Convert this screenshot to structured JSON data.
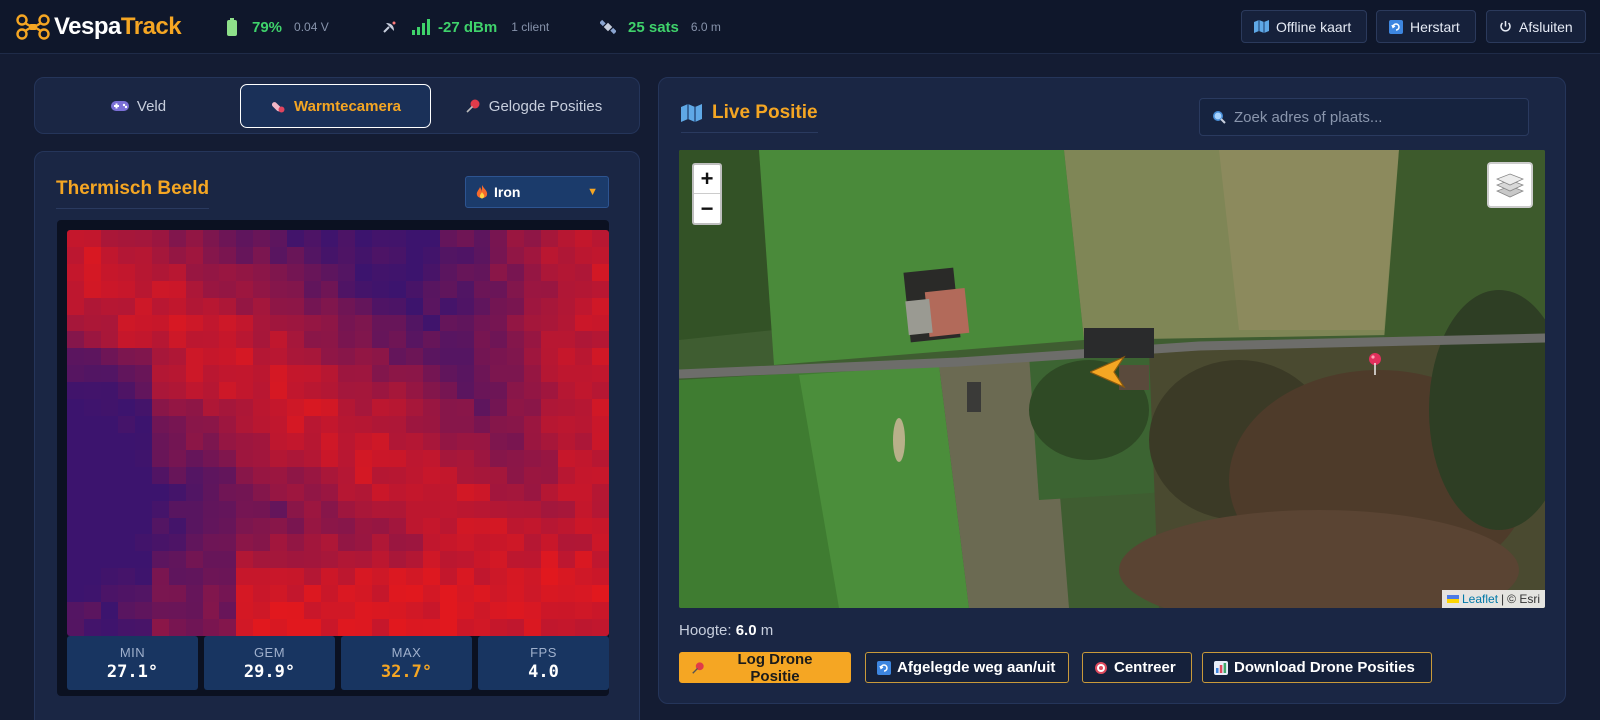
{
  "brand": {
    "name_part1": "Vespa",
    "name_part2": "Track"
  },
  "status": {
    "battery": {
      "percent": "79%",
      "voltage": "0.04 V"
    },
    "signal": {
      "rssi": "-27 dBm",
      "clients": "1 client"
    },
    "gps": {
      "sats": "25 sats",
      "accuracy": "6.0 m"
    }
  },
  "topbar_buttons": {
    "offline": "Offline kaart",
    "restart": "Herstart",
    "shutdown": "Afsluiten"
  },
  "tabs": [
    {
      "label": "Veld",
      "icon": "gamepad-icon"
    },
    {
      "label": "Warmtecamera",
      "icon": "thermometer-icon",
      "active": true
    },
    {
      "label": "Gelogde Posities",
      "icon": "pushpin-icon"
    }
  ],
  "thermal": {
    "title": "Thermisch Beeld",
    "palette_selected": "Iron",
    "stats": [
      {
        "label": "MIN",
        "value": "27.1°"
      },
      {
        "label": "GEM",
        "value": "29.9°"
      },
      {
        "label": "MAX",
        "value": "32.7°"
      },
      {
        "label": "FPS",
        "value": "4.0"
      }
    ],
    "grid": {
      "cols": 32,
      "rows": 24,
      "min_temp": 27.1,
      "max_temp": 32.7
    }
  },
  "map": {
    "title": "Live Positie",
    "search_placeholder": "Zoek adres of plaats...",
    "zoom_in": "+",
    "zoom_out": "−",
    "attribution_link": "Leaflet",
    "attribution_sep": "|",
    "attribution_text": "© Esri",
    "altitude_label": "Hoogte:",
    "altitude_value": "6.0",
    "altitude_unit": "m"
  },
  "actions": {
    "log": "Log Drone Positie",
    "path": "Afgelegde weg aan/uit",
    "center": "Centreer",
    "download": "Download Drone Posities"
  },
  "colors": {
    "accent": "#f5a623",
    "ok": "#3fd26b",
    "bg": "#141c33",
    "panel": "#1a2644"
  }
}
